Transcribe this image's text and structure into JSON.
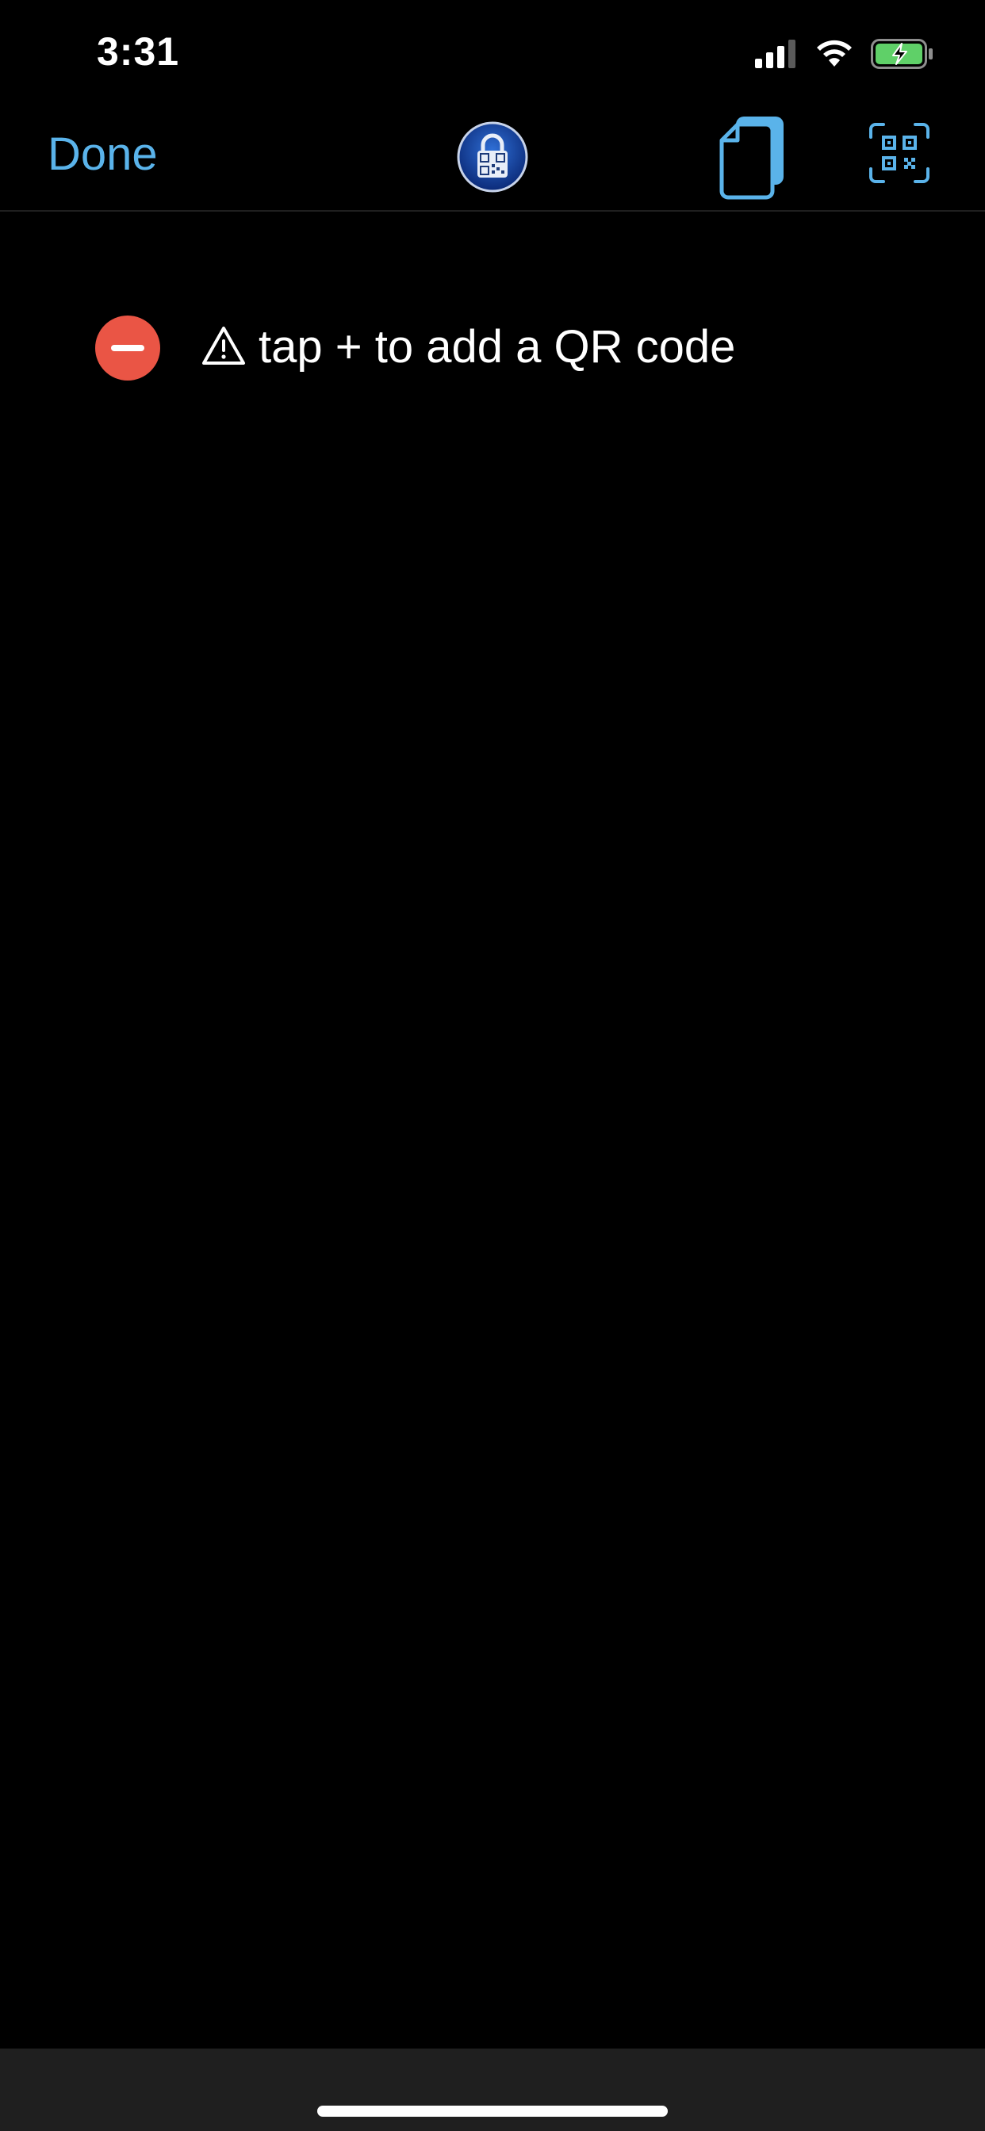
{
  "status_bar": {
    "time": "3:31",
    "icons": [
      "cellular-signal-icon",
      "wifi-icon",
      "battery-charging-icon"
    ]
  },
  "nav": {
    "done_label": "Done",
    "logo_icon": "qr-lock-logo-icon",
    "copy_icon": "copy-icon",
    "scan_icon": "qr-scan-icon",
    "accent_color": "#5ab3ea"
  },
  "list": {
    "rows": [
      {
        "warning_icon": "warning-icon",
        "text": "tap + to add a QR code",
        "delete_icon": "minus-circle-icon",
        "delete_color": "#ea5545"
      }
    ]
  }
}
